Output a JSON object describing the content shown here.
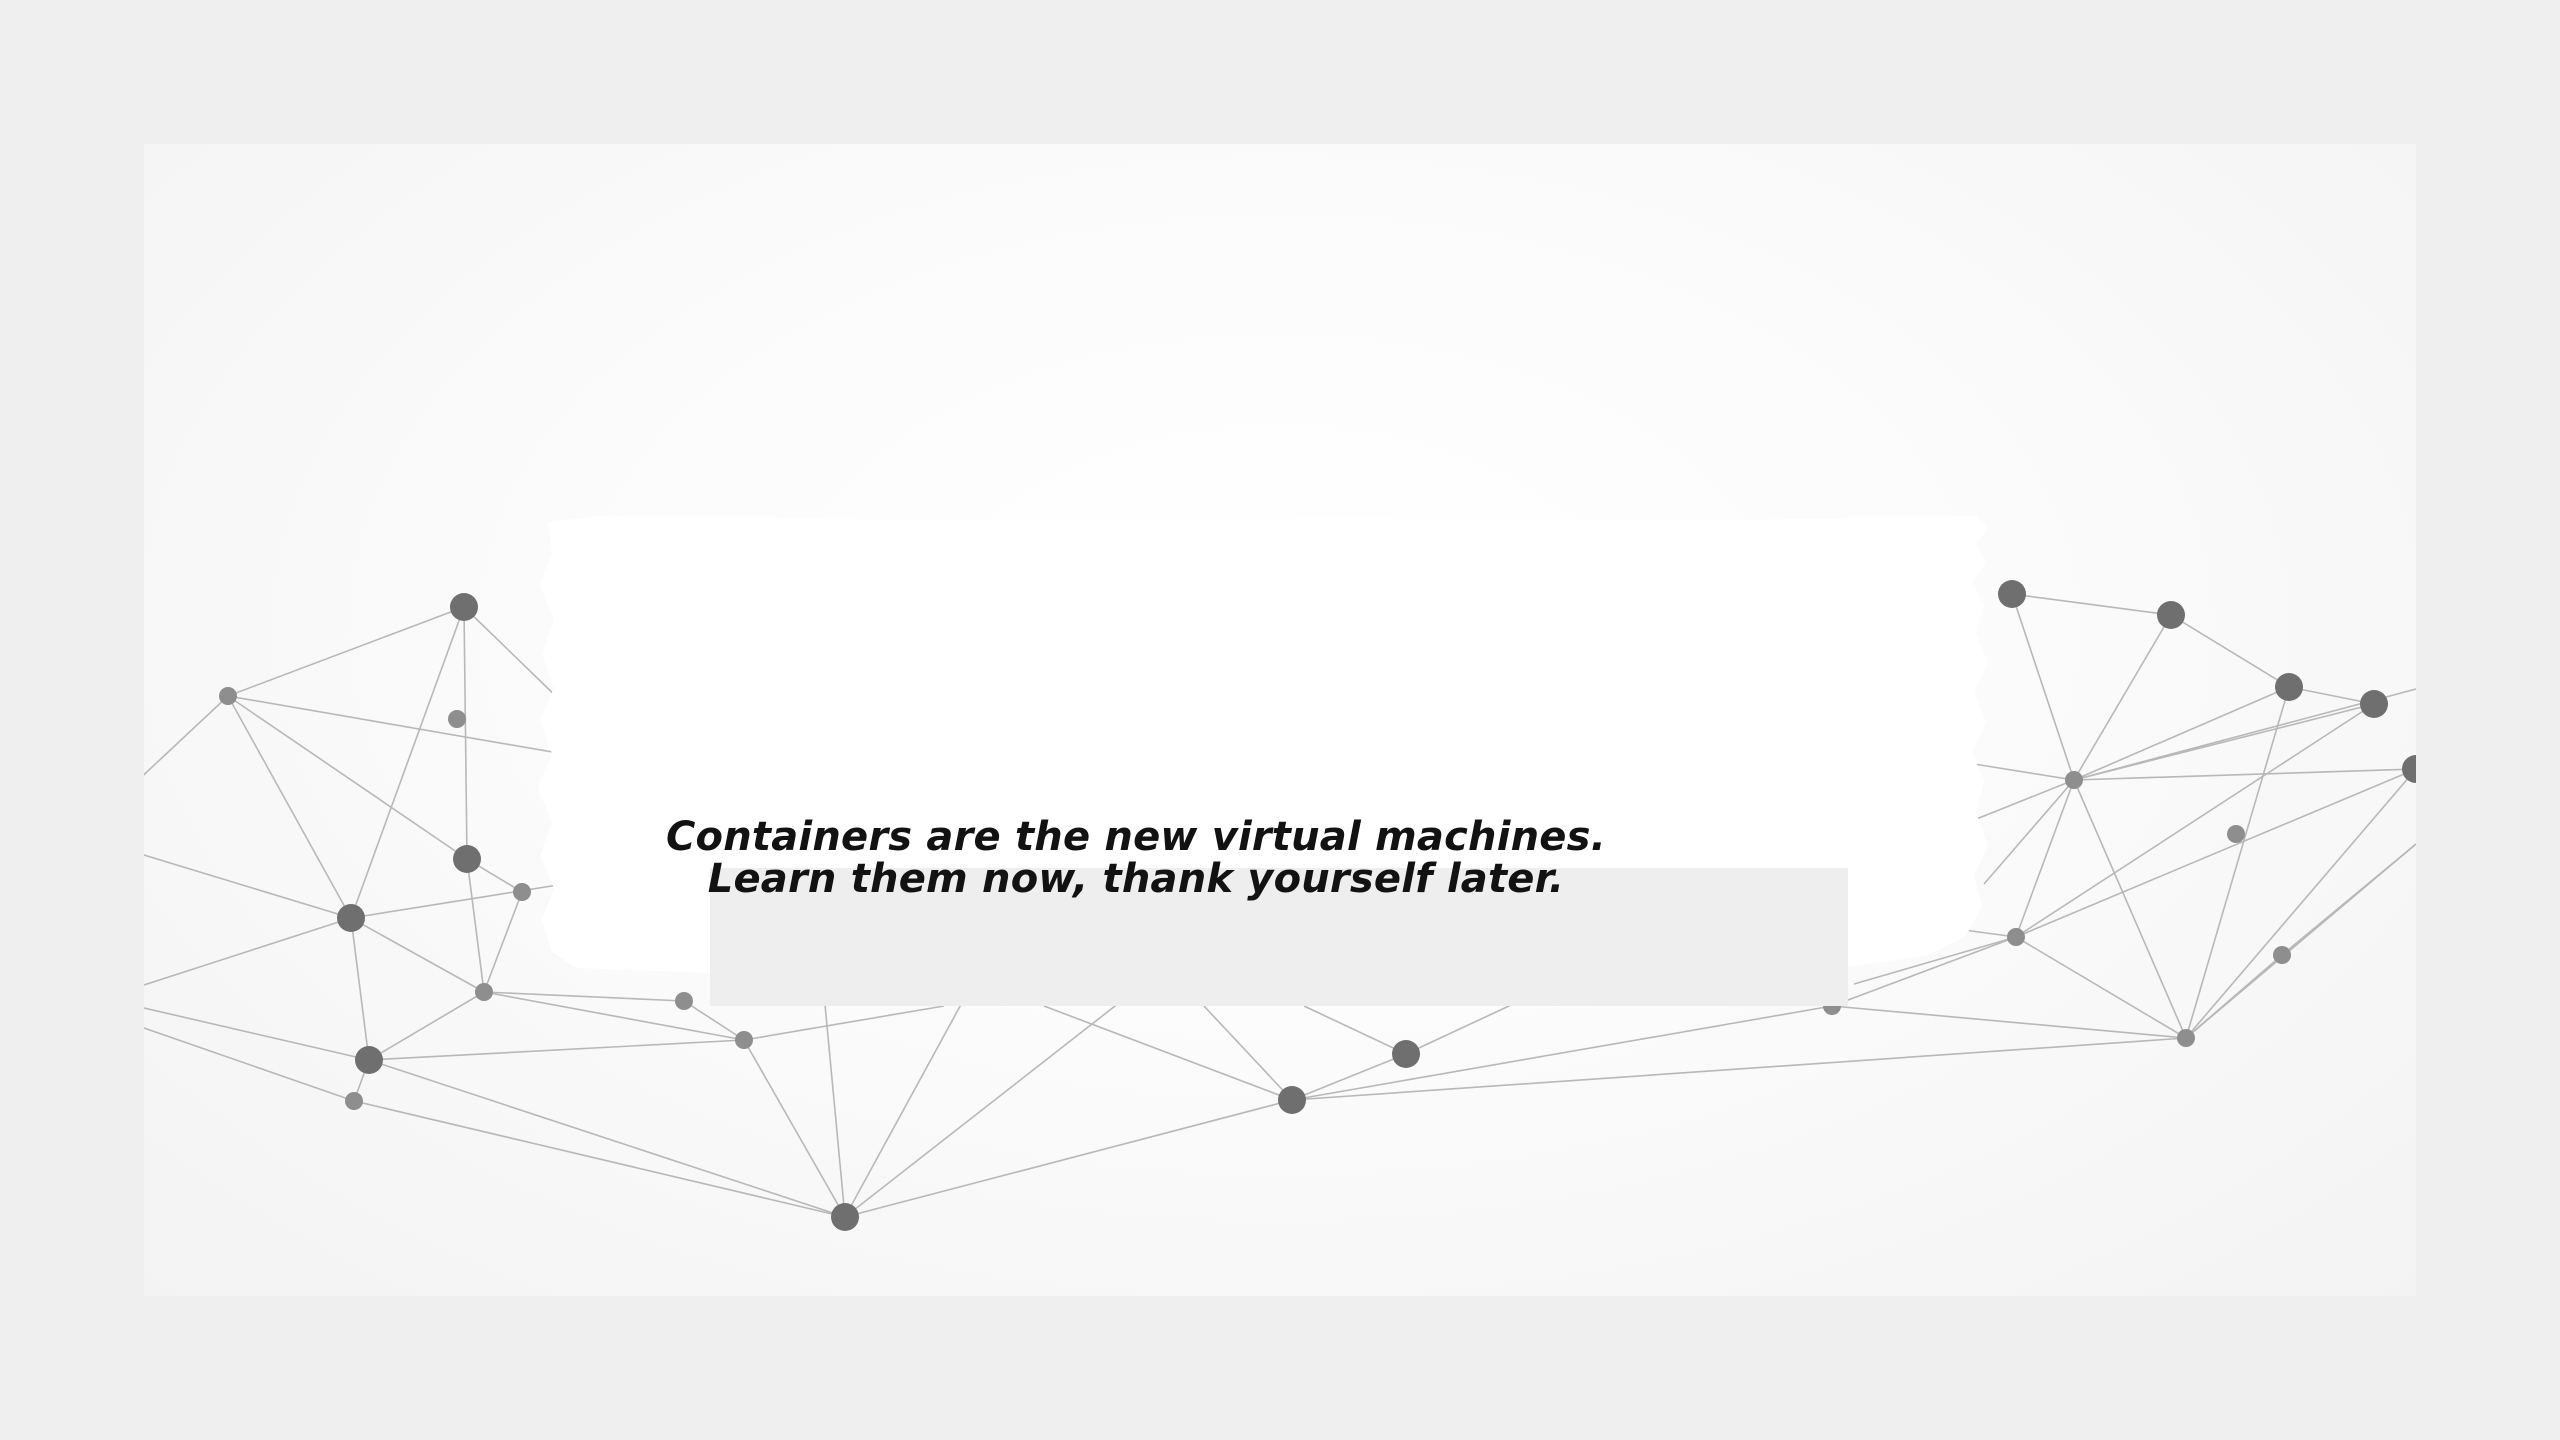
{
  "banner": {
    "line1": "Containers are the new virtual machines.",
    "line2": "Learn them now, thank yourself later."
  },
  "colors": {
    "page_background": "#efefef",
    "banner_background": "#fafafa",
    "node_dark": "#6d6d6d",
    "node_light": "#8c8c8c",
    "edge": "#b4b4b4",
    "text": "#121212"
  },
  "icons": [
    "network-mesh-graphic"
  ]
}
